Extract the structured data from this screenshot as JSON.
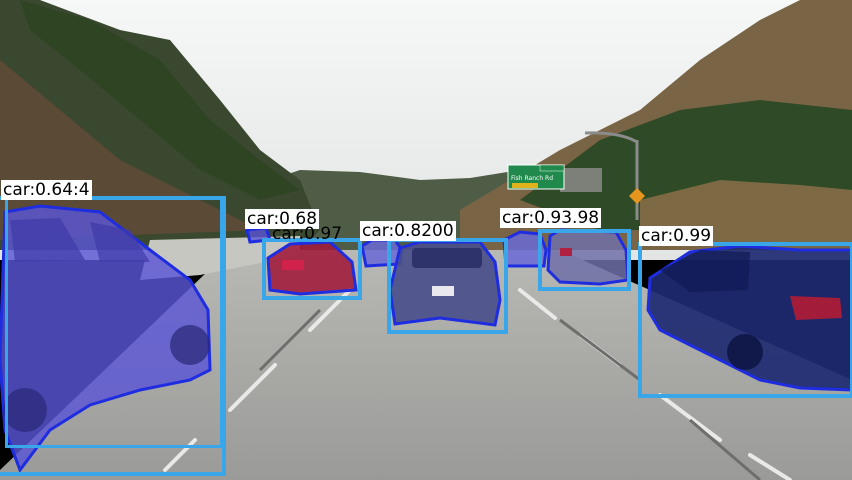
{
  "image": {
    "description_hidden": "",
    "colors": {
      "sky": "#eef0f0",
      "hill_left": "#3f4a30",
      "hill_right": "#6e5c40",
      "foliage": "#2f4a26",
      "road": "#a9a9a7",
      "lane_marking": "#eeeeee",
      "box": "#3aa6ea",
      "mask_fill": "#5a55d6",
      "mask_outline": "#1f2de0",
      "sign_green": "#1f8a4c"
    }
  },
  "road_sign": {
    "text": "Fish Ranch Rd"
  },
  "detections": [
    {
      "label": "car:0.64:4"
    },
    {
      "label": "car:0.68"
    },
    {
      "label": "car:0.97"
    },
    {
      "label": "car:0.8200"
    },
    {
      "label": "car:0.93.98"
    },
    {
      "label": "car:0.99"
    }
  ]
}
